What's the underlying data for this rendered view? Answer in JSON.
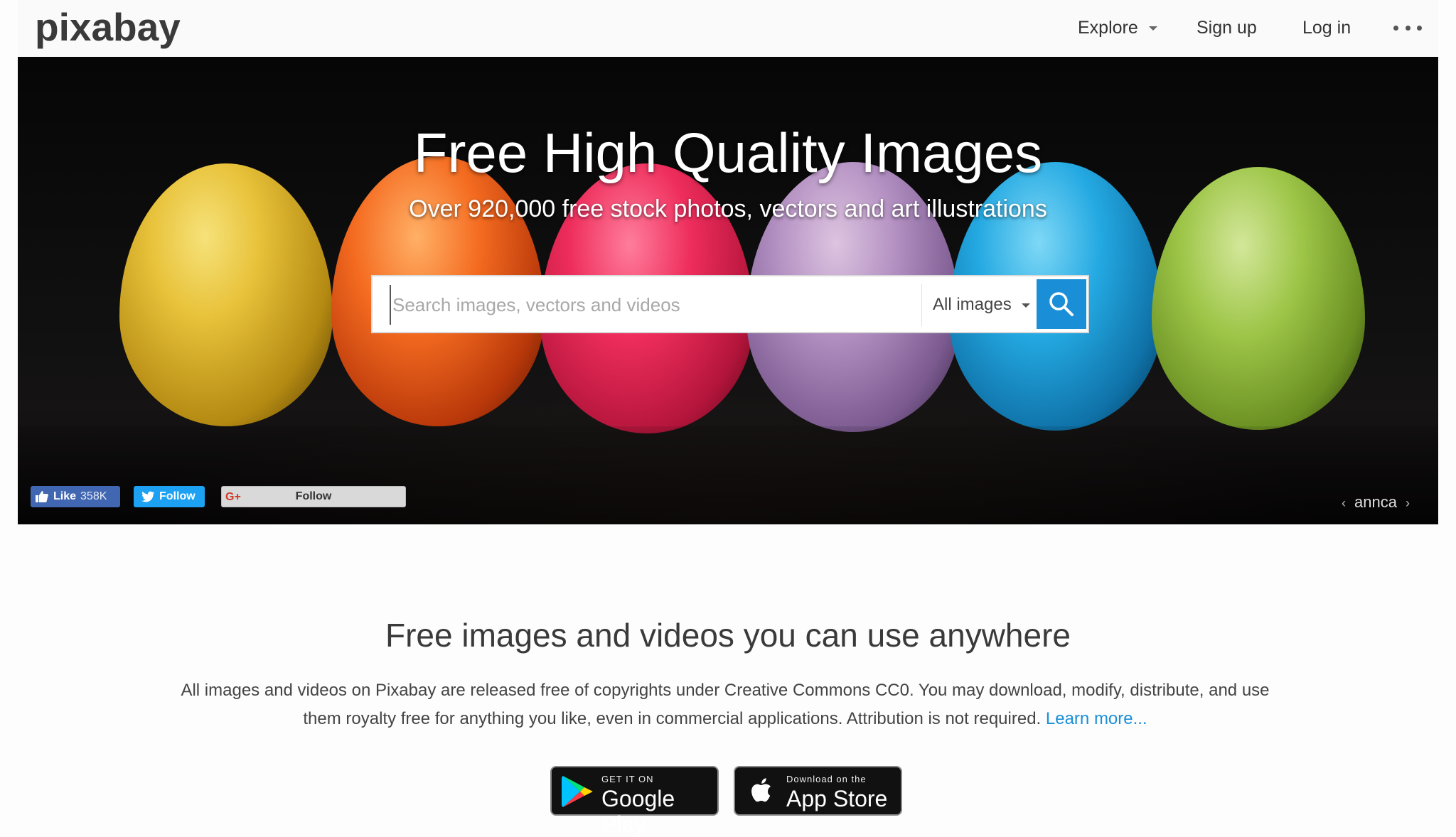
{
  "header": {
    "logo": "pixabay",
    "nav": {
      "explore": "Explore",
      "signup": "Sign up",
      "login": "Log in"
    },
    "more_icon": "more-dots-icon"
  },
  "hero": {
    "title": "Free High Quality Images",
    "subtitle": "Over 920,000 free stock photos, vectors and art illustrations",
    "search": {
      "placeholder": "Search images, vectors and videos",
      "value": "",
      "type_selected": "All images",
      "button_icon": "search-icon",
      "button_color": "#1a8fd8"
    },
    "social": {
      "facebook_like": "Like",
      "facebook_count": "358K",
      "twitter_follow": "Follow",
      "googleplus_icon": "G+",
      "googleplus_follow": "Follow"
    },
    "photo_credit": "annca"
  },
  "content": {
    "title": "Free images and videos you can use anywhere",
    "text": "All images and videos on Pixabay are released free of copyrights under Creative Commons CC0. You may download, modify, distribute, and use them royalty free for anything you like, even in commercial applications. Attribution is not required.",
    "learn_more": "Learn more...",
    "badges": {
      "google_small": "GET IT ON",
      "google_big": "Google Play",
      "apple_small": "Download on the",
      "apple_big": "App Store"
    }
  }
}
